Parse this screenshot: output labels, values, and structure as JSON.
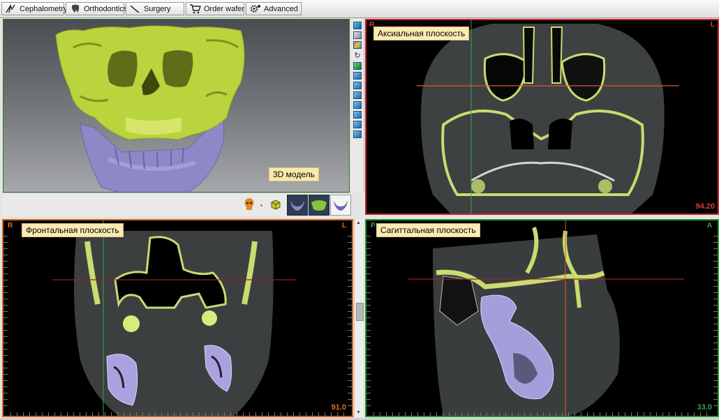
{
  "tabs": [
    {
      "label": "Cephalometry",
      "icon": "cephalometry-icon"
    },
    {
      "label": "Orthodontics",
      "icon": "tooth-icon"
    },
    {
      "label": "Surgery",
      "icon": "scalpel-icon"
    },
    {
      "label": "Order wafer",
      "icon": "cart-icon"
    },
    {
      "label": "Advanced",
      "icon": "gear-icon"
    }
  ],
  "viewports": {
    "model3d": {
      "label": "3D модель"
    },
    "axial": {
      "label": "Аксиальная плоскость",
      "left_marker": "R",
      "right_marker": "L",
      "value": "94.20",
      "border_color": "#c8262f"
    },
    "frontal": {
      "label": "Фронтальная плоскость",
      "left_marker": "R",
      "right_marker": "L",
      "value": "91.0",
      "border_color": "#d3641b"
    },
    "sagittal": {
      "label": "Сагиттальная плоскость",
      "left_marker": "P",
      "right_marker": "A",
      "value": "33.0",
      "border_color": "#1f9a2a"
    }
  },
  "colors": {
    "bone": "#c4d84a",
    "mandible": "#8c86c7",
    "axial_line": "#d85a2a",
    "coronal_line": "#b22",
    "sagittal_line": "#3aa34a"
  }
}
